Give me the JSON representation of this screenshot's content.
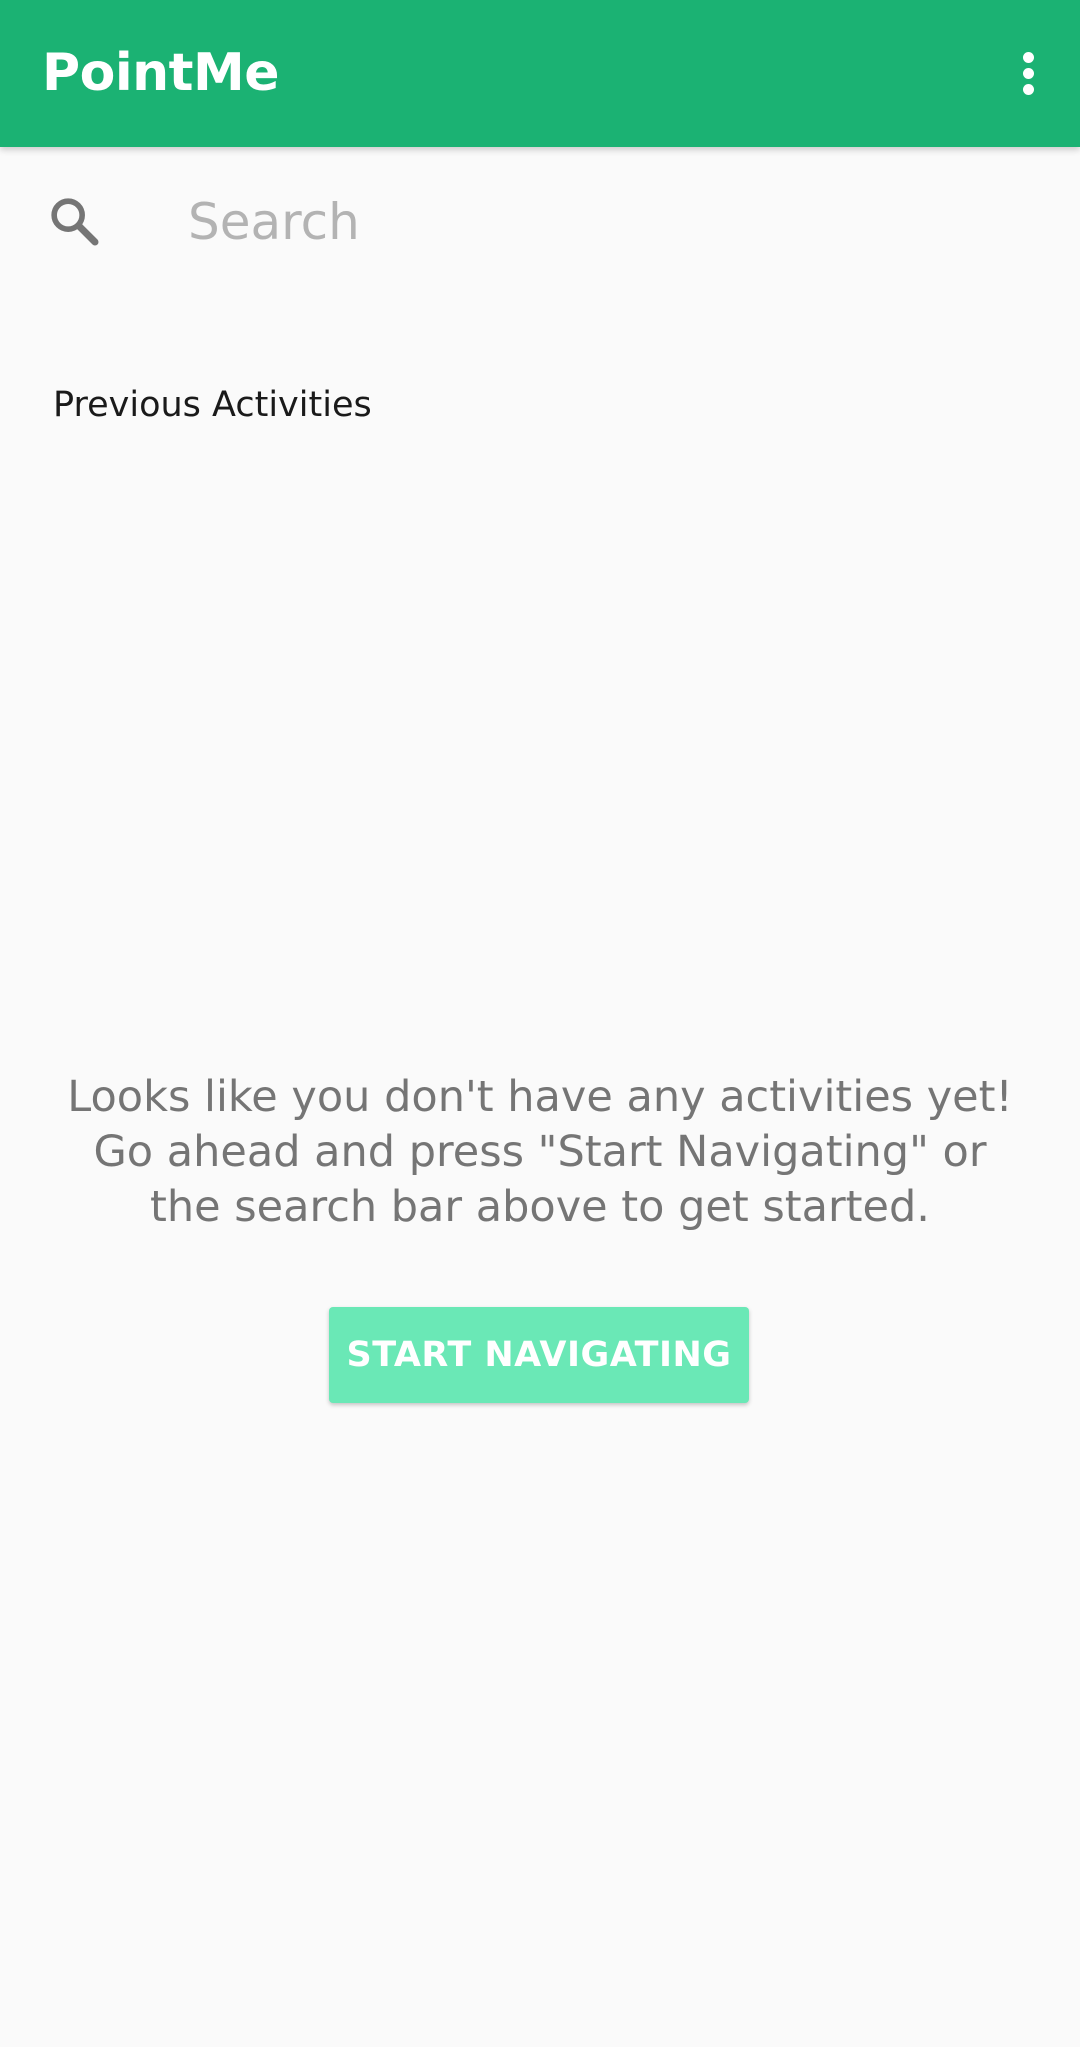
{
  "app_bar": {
    "title": "PointMe",
    "background_color": "#1bb273",
    "menu_icon": "more-vertical-icon"
  },
  "search": {
    "icon": "search-icon",
    "placeholder": "Search",
    "value": ""
  },
  "activities": {
    "section_title": "Previous Activities",
    "items": []
  },
  "empty_state": {
    "message": "Looks like you don't have any activities yet!\nGo ahead and press \"Start Navigating\" or\nthe search bar above to get started.",
    "button_label": "START NAVIGATING",
    "button_color": "#6ae8b6"
  }
}
